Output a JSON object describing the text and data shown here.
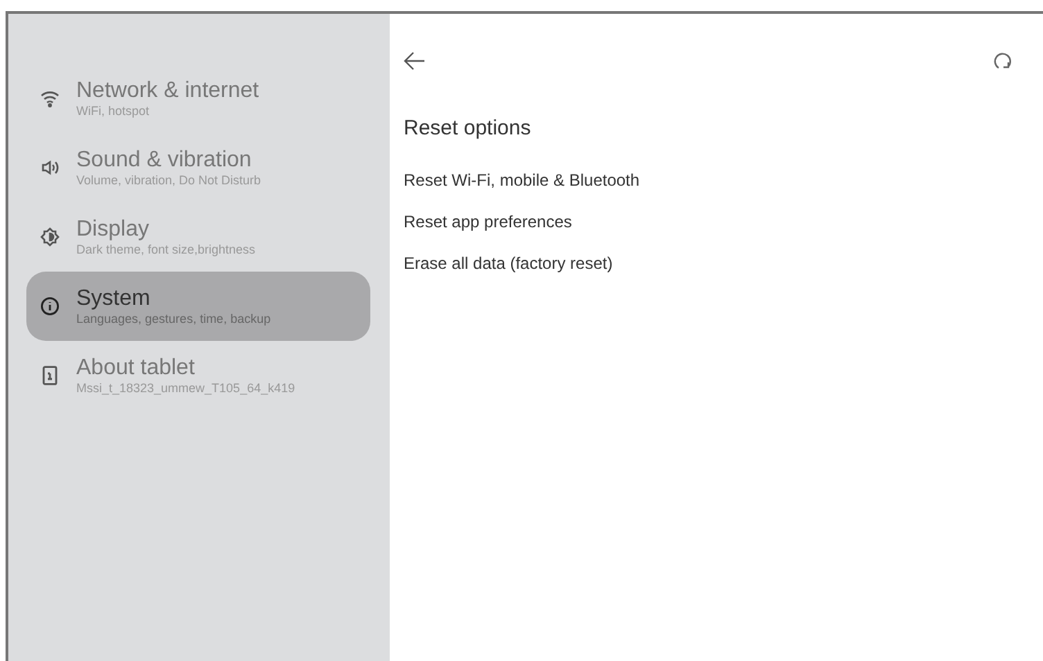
{
  "sidebar": {
    "items": [
      {
        "kind": "wifi",
        "title": "Network & internet",
        "subtitle": "WiFi, hotspot",
        "selected": false
      },
      {
        "kind": "sound",
        "title": "Sound & vibration",
        "subtitle": "Volume, vibration, Do Not Disturb",
        "selected": false
      },
      {
        "kind": "display",
        "title": "Display",
        "subtitle": "Dark theme, font size,brightness",
        "selected": false
      },
      {
        "kind": "info",
        "title": "System",
        "subtitle": "Languages, gestures, time, backup",
        "selected": true
      },
      {
        "kind": "tablet",
        "title": "About tablet",
        "subtitle": "Mssi_t_18323_ummew_T105_64_k419",
        "selected": false
      }
    ]
  },
  "content": {
    "title": "Reset options",
    "options": [
      "Reset Wi-Fi, mobile & Bluetooth",
      "Reset app preferences",
      "Erase all data (factory reset)"
    ]
  }
}
